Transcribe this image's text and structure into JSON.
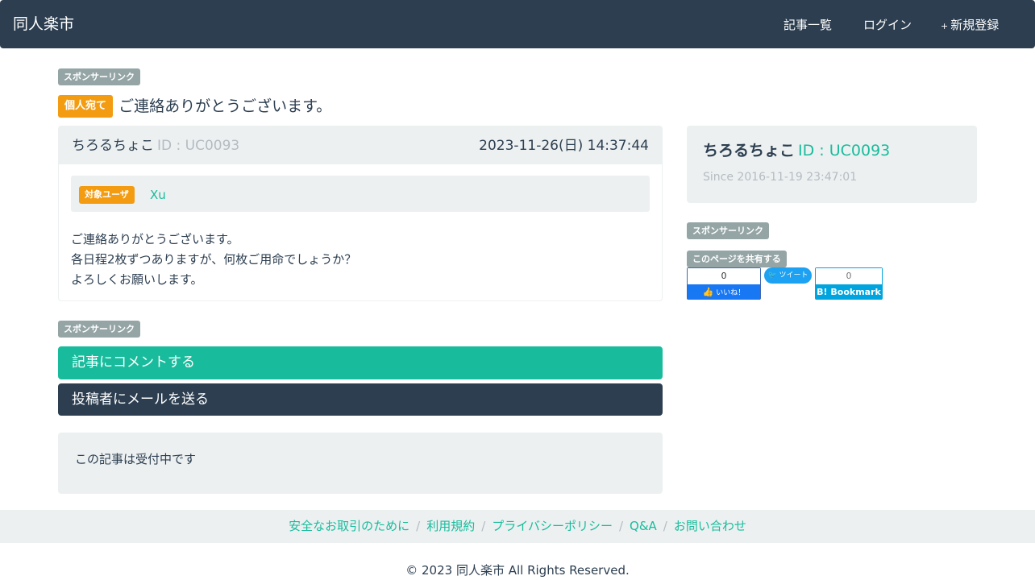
{
  "nav": {
    "brand": "同人楽市",
    "items": [
      {
        "icon": "list-icon",
        "glyph": "",
        "label": "記事一覧"
      },
      {
        "icon": "login-icon",
        "glyph": "",
        "label": "ログイン"
      },
      {
        "icon": "plus-icon",
        "glyph": "+",
        "label": "新規登録"
      }
    ]
  },
  "sponsor_label": "スポンサーリンク",
  "post": {
    "type_badge": "個人宛て",
    "title": "ご連絡ありがとうございます。",
    "author": "ちろるちょこ",
    "author_id": "ID : UC0093",
    "posted_at": "2023-11-26(日) 14:37:44",
    "target_label": "対象ユーザ",
    "target_user": "Xu",
    "body": [
      "ご連絡ありがとうございます。",
      "各日程2枚ずつありますが、何枚ご用命でしょうか？",
      "よろしくお願いします。"
    ]
  },
  "actions": {
    "comment": "記事にコメントする",
    "mail": "投稿者にメールを送る"
  },
  "status": "この記事は受付中です",
  "sidebar": {
    "author": "ちろるちょこ",
    "author_id": "ID : UC0093",
    "since": "Since 2016-11-19 23:47:01",
    "share_label": "このページを共有する",
    "fb_count": "0",
    "fb_label": "いいね！",
    "tw_label": "ツイート",
    "hb_count": "0",
    "hb_label": "B! Bookmark"
  },
  "footer": {
    "links": [
      "安全なお取引のために",
      "利用規約",
      "プライバシーポリシー",
      "Q&A",
      "お問い合わせ"
    ],
    "copyright": "© 2023 同人楽市 All Rights Reserved."
  },
  "colors": {
    "navbar": "#2c3e50",
    "accent": "#18bc9c",
    "badge_orange": "#f39c12",
    "badge_gray": "#95a5a6",
    "well": "#ecf0f1"
  }
}
